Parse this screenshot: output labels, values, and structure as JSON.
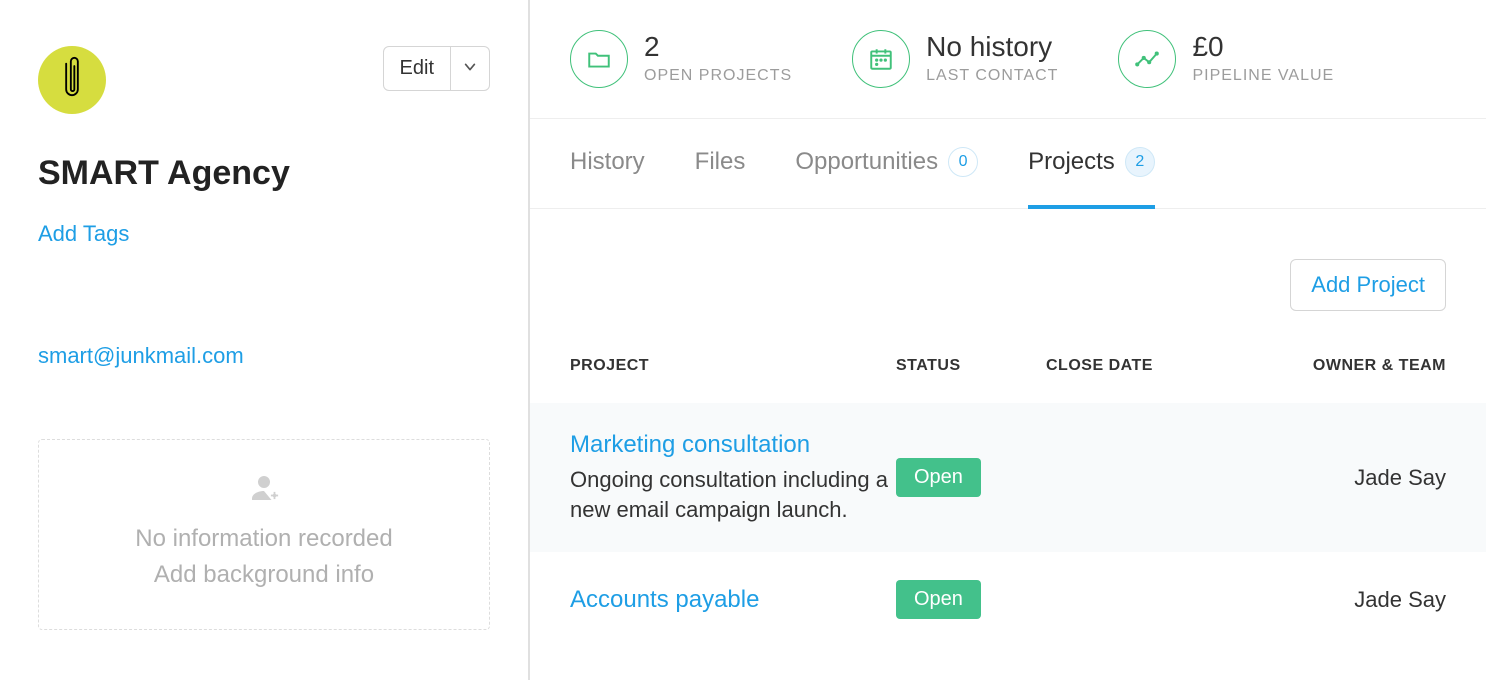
{
  "sidebar": {
    "edit_label": "Edit",
    "org_name": "SMART Agency",
    "add_tags_label": "Add Tags",
    "email": "smart@junkmail.com",
    "bg_line1": "No information recorded",
    "bg_line2": "Add background info"
  },
  "stats": {
    "open_projects": {
      "value": "2",
      "label": "OPEN PROJECTS"
    },
    "last_contact": {
      "value": "No history",
      "label": "LAST CONTACT"
    },
    "pipeline": {
      "value": "£0",
      "label": "PIPELINE VALUE"
    }
  },
  "tabs": {
    "history": "History",
    "files": "Files",
    "opportunities": {
      "label": "Opportunities",
      "count": "0"
    },
    "projects": {
      "label": "Projects",
      "count": "2"
    }
  },
  "actions": {
    "add_project": "Add Project"
  },
  "table": {
    "headers": {
      "project": "PROJECT",
      "status": "STATUS",
      "close_date": "CLOSE DATE",
      "owner": "OWNER & TEAM"
    },
    "rows": [
      {
        "title": "Marketing consultation",
        "desc": "Ongoing consultation including a new email campaign launch.",
        "status": "Open",
        "close_date": "",
        "owner": "Jade Say"
      },
      {
        "title": "Accounts payable",
        "desc": "",
        "status": "Open",
        "close_date": "",
        "owner": "Jade Say"
      }
    ]
  }
}
